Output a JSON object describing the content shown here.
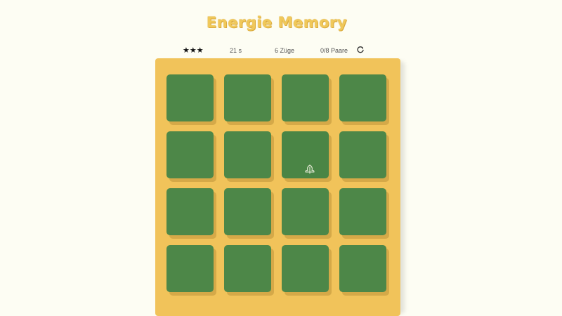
{
  "game": {
    "title": "Energie Memory",
    "stars": "★★★",
    "star_count": 3,
    "time": "21 s",
    "moves": "6 Züge",
    "pairs": "0/8 Paare",
    "reset_icon": "refresh-icon"
  },
  "board": {
    "rows": 4,
    "columns": 4,
    "cards": [
      {
        "state": "face-down"
      },
      {
        "state": "face-down"
      },
      {
        "state": "face-down"
      },
      {
        "state": "face-down"
      },
      {
        "state": "face-down"
      },
      {
        "state": "face-down"
      },
      {
        "state": "face-down",
        "hovered": true,
        "icon": "leaf-icon"
      },
      {
        "state": "face-down"
      },
      {
        "state": "face-down"
      },
      {
        "state": "face-down"
      },
      {
        "state": "face-down"
      },
      {
        "state": "face-down"
      },
      {
        "state": "face-down"
      },
      {
        "state": "face-down"
      },
      {
        "state": "face-down"
      },
      {
        "state": "face-down"
      }
    ]
  },
  "colors": {
    "background": "#fdfdf3",
    "title": "#f0c85a",
    "board": "#f1c35a",
    "card_back": "#4d8748"
  }
}
